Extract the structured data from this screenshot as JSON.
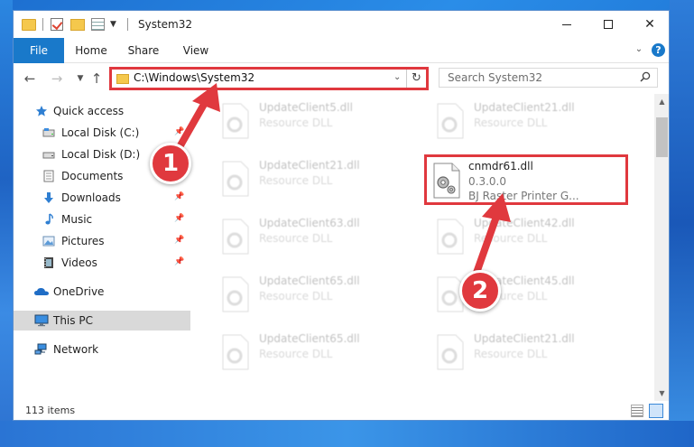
{
  "window": {
    "title": "System32",
    "controls": {
      "minimize": "",
      "maximize": "",
      "close": "✕"
    }
  },
  "ribbon": {
    "tabs": [
      {
        "label": "File"
      },
      {
        "label": "Home"
      },
      {
        "label": "Share"
      },
      {
        "label": "View"
      }
    ]
  },
  "navbar": {
    "address": "C:\\Windows\\System32",
    "search_placeholder": "Search System32"
  },
  "sidebar": {
    "items": [
      {
        "label": "Quick access",
        "icon": "star-icon"
      },
      {
        "label": "Local Disk (C:)",
        "icon": "drive-icon"
      },
      {
        "label": "Local Disk (D:)",
        "icon": "drive-icon"
      },
      {
        "label": "Documents",
        "icon": "documents-icon"
      },
      {
        "label": "Downloads",
        "icon": "download-icon"
      },
      {
        "label": "Music",
        "icon": "music-icon"
      },
      {
        "label": "Pictures",
        "icon": "pictures-icon"
      },
      {
        "label": "Videos",
        "icon": "videos-icon"
      },
      {
        "label": "OneDrive",
        "icon": "cloud-icon"
      },
      {
        "label": "This PC",
        "icon": "computer-icon"
      },
      {
        "label": "Network",
        "icon": "network-icon"
      }
    ]
  },
  "files": [
    {
      "name": "UpdateClient5.dll",
      "desc": "Resource DLL"
    },
    {
      "name": "UpdateClient21.dll",
      "desc": "Resource DLL"
    },
    {
      "name": "UpdateClient21.dll",
      "desc": "Resource DLL"
    },
    {
      "name": "cnmdr61.dll",
      "version": "0.3.0.0",
      "desc": "BJ Raster Printer G..."
    },
    {
      "name": "UpdateClient63.dll",
      "desc": "Resource DLL"
    },
    {
      "name": "UpdateClient42.dll",
      "desc": "Resource DLL"
    },
    {
      "name": "UpdateClient65.dll",
      "desc": "Resource DLL"
    },
    {
      "name": "UpdateClient45.dll",
      "desc": "Resource DLL"
    },
    {
      "name": "UpdateClient65.dll",
      "desc": "Resource DLL"
    },
    {
      "name": "UpdateClient21.dll",
      "desc": "Resource DLL"
    }
  ],
  "status": {
    "item_count": "113 items"
  },
  "annotations": {
    "step1": "1",
    "step2": "2"
  },
  "colors": {
    "highlight": "#e0383e",
    "accent": "#1979ca"
  }
}
